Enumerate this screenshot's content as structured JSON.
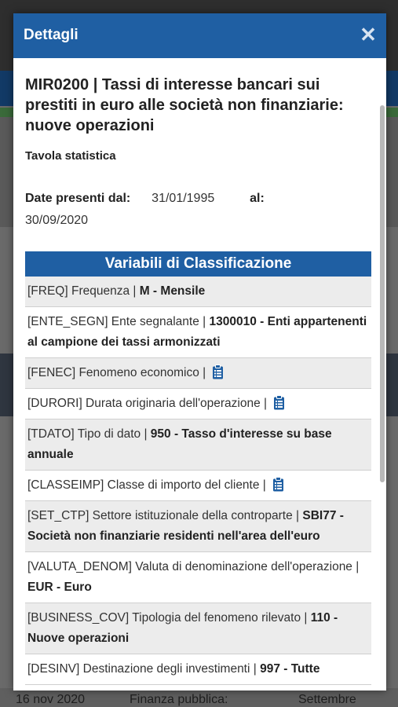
{
  "background": {
    "footer_date": "16 nov 2020",
    "footer_category": "Finanza pubblica:",
    "footer_month": "Settembre"
  },
  "modal": {
    "header_title": "Dettagli",
    "close_symbol": "✕",
    "title": "MIR0200 | Tassi di interesse bancari sui prestiti in euro alle società non finanziarie: nuove operazioni",
    "subtitle": "Tavola statistica",
    "dates_label": "Date presenti dal:",
    "date_from": "31/01/1995",
    "dates_to_label": "al:",
    "date_to": "30/09/2020",
    "section_title": "Variabili di Classificazione",
    "variables": [
      {
        "code": "[FREQ] Frequenza | ",
        "value": "M - Mensile",
        "icon": false
      },
      {
        "code": "[ENTE_SEGN] Ente segnalante | ",
        "value": "1300010 - Enti appartenenti al campione dei tassi armonizzati",
        "icon": false
      },
      {
        "code": "[FENEC] Fenomeno economico | ",
        "value": "",
        "icon": true
      },
      {
        "code": "[DURORI] Durata originaria dell'operazione | ",
        "value": "",
        "icon": true
      },
      {
        "code": "[TDATO] Tipo di dato | ",
        "value": "950 - Tasso d'interesse su base annuale",
        "icon": false
      },
      {
        "code": "[CLASSEIMP] Classe di importo del cliente | ",
        "value": "",
        "icon": true
      },
      {
        "code": "[SET_CTP] Settore istituzionale della controparte | ",
        "value": "SBI77 - Società non finanziarie residenti nell'area dell'euro",
        "icon": false
      },
      {
        "code": "[VALUTA_DENOM] Valuta di denominazione dell'operazione | ",
        "value": "EUR - Euro",
        "icon": false
      },
      {
        "code": "[BUSINESS_COV] Tipologia del fenomeno rilevato | ",
        "value": "110 - Nuove operazioni",
        "icon": false
      },
      {
        "code": "[DESINV] Destinazione degli investimenti | ",
        "value": "997 - Tutte",
        "icon": false
      }
    ]
  }
}
